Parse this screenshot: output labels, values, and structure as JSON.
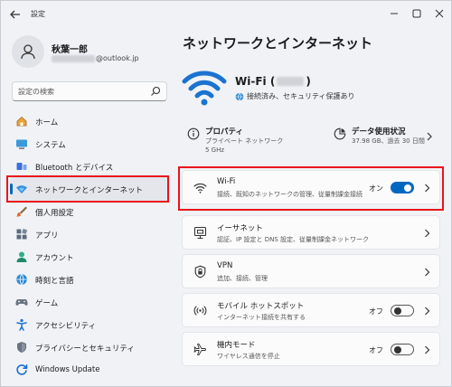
{
  "window": {
    "title": "設定"
  },
  "profile": {
    "name": "秋葉一郎",
    "email_domain": "@outlook.jp"
  },
  "search": {
    "placeholder": "設定の検索"
  },
  "sidebar": {
    "items": [
      {
        "label": "ホーム",
        "icon": "home-icon"
      },
      {
        "label": "システム",
        "icon": "system-icon"
      },
      {
        "label": "Bluetooth とデバイス",
        "icon": "bluetooth-icon"
      },
      {
        "label": "ネットワークとインターネット",
        "icon": "network-icon",
        "active": true
      },
      {
        "label": "個人用設定",
        "icon": "brush-icon"
      },
      {
        "label": "アプリ",
        "icon": "apps-icon"
      },
      {
        "label": "アカウント",
        "icon": "account-icon"
      },
      {
        "label": "時刻と言語",
        "icon": "time-language-icon"
      },
      {
        "label": "ゲーム",
        "icon": "gaming-icon"
      },
      {
        "label": "アクセシビリティ",
        "icon": "accessibility-icon"
      },
      {
        "label": "プライバシーとセキュリティ",
        "icon": "shield-icon"
      },
      {
        "label": "Windows Update",
        "icon": "update-icon"
      }
    ]
  },
  "main": {
    "title": "ネットワークとインターネット",
    "hero": {
      "name_prefix": "Wi-Fi (",
      "name_suffix": ")",
      "status": "接続済み、セキュリティ保護あり"
    },
    "info": {
      "properties_title": "プロパティ",
      "properties_sub1": "プライベート ネットワーク",
      "properties_sub2": "5 GHz",
      "usage_title": "データ使用状況",
      "usage_sub": "37.98 GB、過去 30 日間"
    },
    "cards": [
      {
        "title": "Wi-Fi",
        "sub": "接続、既知のネットワークの管理、従量制課金接続",
        "state": "オン",
        "toggle": "on"
      },
      {
        "title": "イーサネット",
        "sub": "認証、IP 設定と DNS 設定、従量制課金ネットワーク"
      },
      {
        "title": "VPN",
        "sub": "追加、接続、管理"
      },
      {
        "title": "モバイル ホットスポット",
        "sub": "インターネット接続を共有する",
        "state": "オフ",
        "toggle": "off"
      },
      {
        "title": "機内モード",
        "sub": "ワイヤレス通信を停止",
        "state": "オフ",
        "toggle": "off"
      }
    ]
  },
  "colors": {
    "accent": "#0067c0",
    "highlight": "#e8141b"
  }
}
